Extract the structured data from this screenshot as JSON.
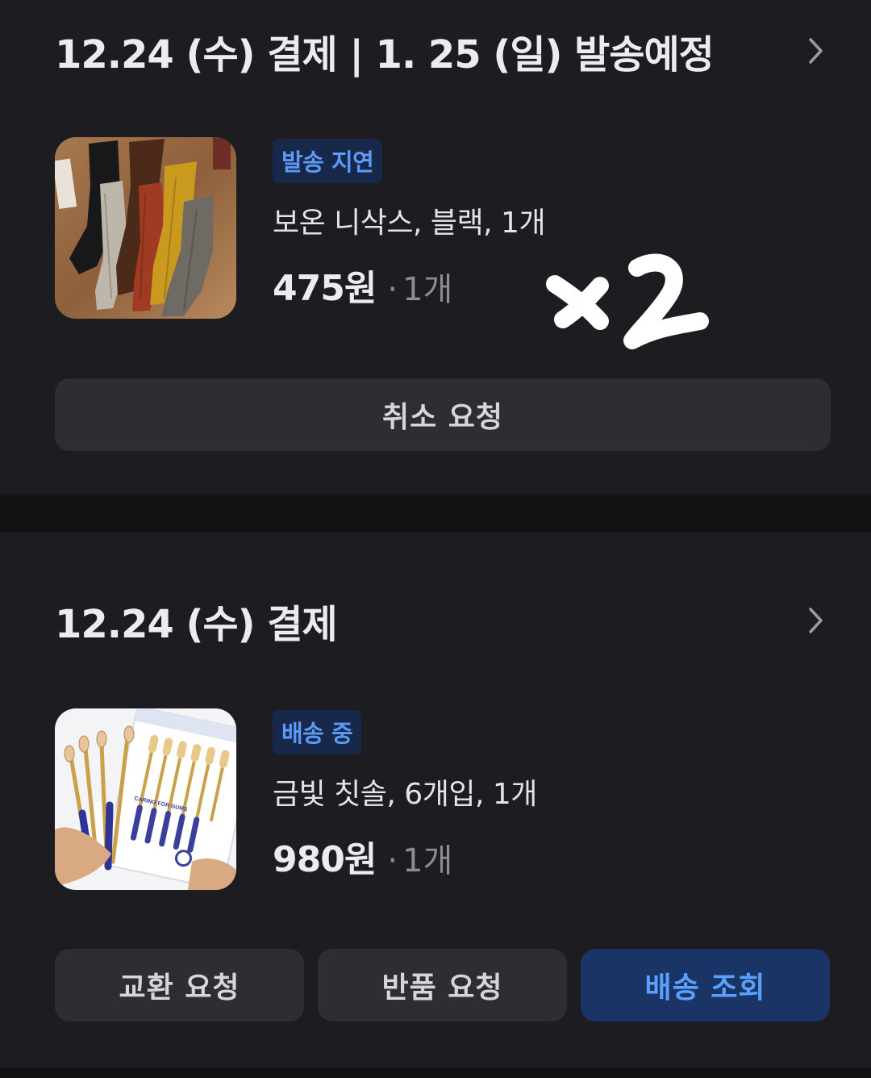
{
  "orders": [
    {
      "title": "12.24 (수) 결제 | 1. 25 (일) 발송예정",
      "item": {
        "status": "발송 지연",
        "name": "보온 니삭스, 블랙, 1개",
        "price": "475원",
        "qty": "1개",
        "thumb_icon": "socks-photo"
      },
      "handwritten_note": "x2",
      "buttons": {
        "cancel": "취소 요청"
      }
    },
    {
      "title": "12.24 (수) 결제",
      "item": {
        "status": "배송 중",
        "name": "금빛 칫솔, 6개입, 1개",
        "price": "980원",
        "qty": "1개",
        "thumb_icon": "toothbrush-photo",
        "package_text": "CARING FOR GUMS"
      },
      "buttons": {
        "exchange": "교환 요청",
        "return": "반품 요청",
        "track": "배송 조회"
      }
    }
  ],
  "colors": {
    "page_bg": "#111114",
    "card_bg": "#1c1c21",
    "button_bg": "#2d2e34",
    "badge_bg": "#17284a",
    "badge_text": "#5b9bf5",
    "primary_btn_bg": "#1a3565",
    "primary_btn_text": "#5ba0ff"
  }
}
